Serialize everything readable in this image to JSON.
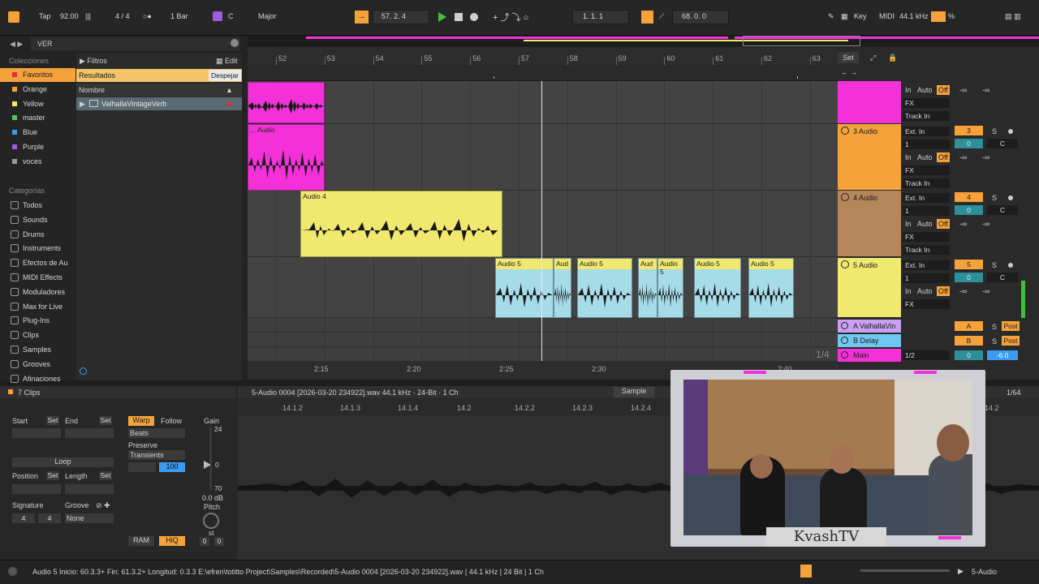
{
  "topbar": {
    "tap": "Tap",
    "tempo": "92.00",
    "meter": "4 / 4",
    "quantize": "1 Bar",
    "key_root": "C",
    "key_scale": "Major",
    "position": "57.   2.   4",
    "loop_start": "1.   1.   1",
    "loop_length": "68.   0.   0",
    "key_label": "Key",
    "midi_label": "MIDI",
    "sample_rate": "44.1 kHz",
    "cpu": "%"
  },
  "browser": {
    "search": "VER",
    "colecciones_title": "Colecciones",
    "colecciones": [
      {
        "label": "Favoritos",
        "color": "#e03030"
      },
      {
        "label": "Orange",
        "color": "#f5a23b"
      },
      {
        "label": "Yellow",
        "color": "#f1e870"
      },
      {
        "label": "master",
        "color": "#58c25a"
      },
      {
        "label": "Blue",
        "color": "#3c9bf0"
      },
      {
        "label": "Purple",
        "color": "#a05be0"
      },
      {
        "label": "voces",
        "color": "#9a9a9a"
      }
    ],
    "categorias_title": "Categorías",
    "categorias": [
      "Todos",
      "Sounds",
      "Drums",
      "Instruments",
      "Efectos de Au",
      "MIDI Effects",
      "Moduladores",
      "Max for Live",
      "Plug-Ins",
      "Clips",
      "Samples",
      "Grooves",
      "Afinaciones"
    ],
    "filtros": "Filtros",
    "edit": "Edit",
    "resultados": "Resultados",
    "despejar": "Despejar",
    "nombre": "Nombre",
    "result_item": "ValhallaVintageVerb"
  },
  "ruler": {
    "bars": [
      "52",
      "53",
      "54",
      "55",
      "56",
      "57",
      "58",
      "59",
      "60",
      "61",
      "62",
      "63"
    ],
    "times": [
      "2:15",
      "2:20",
      "2:25",
      "2:30",
      "2:40"
    ],
    "set": "Set",
    "zoom": "1/4"
  },
  "clips": {
    "audio_top": "... Audio",
    "audio4": "Audio 4",
    "audio5": [
      "Audio 5",
      "Aud",
      "Audio 5",
      "Aud",
      "Audio 5",
      "Audio 5",
      "Audio 5"
    ]
  },
  "tracks": [
    {
      "name": "",
      "color": "#f431d9",
      "in": "In",
      "auto": "Auto",
      "off": "Off",
      "fx": "FX",
      "trackin": "Track In"
    },
    {
      "name": "3 Audio",
      "color": "#f5a23b",
      "extin": "Ext. In",
      "ch": "1",
      "num": "3",
      "vol": "0",
      "pan": "C"
    },
    {
      "name": "4 Audio",
      "color": "#b5865a",
      "extin": "Ext. In",
      "ch": "1",
      "num": "4",
      "vol": "0",
      "pan": "C"
    },
    {
      "name": "5 Audio",
      "color": "#f1e870",
      "extin": "Ext. In",
      "ch": "1",
      "num": "5",
      "vol": "0",
      "pan": "C"
    }
  ],
  "returns": [
    {
      "name": "A ValhallaVin",
      "color": "#c9a0f2",
      "letter": "A",
      "post": "Post"
    },
    {
      "name": "B Delay",
      "color": "#6fc8f0",
      "letter": "B",
      "post": "Post"
    },
    {
      "name": "Main",
      "color": "#f431d9",
      "send": "1/2",
      "vol": "0",
      "db": "-6.0"
    }
  ],
  "mixer_labels": {
    "neg_inf": "-∞",
    "solo": "S"
  },
  "detail": {
    "clips_count": "7 Clips",
    "file": "5-Audio 0004 [2026-03-20 234922].wav  44.1 kHz · 24-Bit · 1 Ch",
    "sample_tab": "Sample",
    "grid": "1/64",
    "start": "Start",
    "set": "Set",
    "end": "End",
    "loop": "Loop",
    "position": "Position",
    "length": "Length",
    "signature": "Signature",
    "groove": "Groove",
    "sig_num": "4",
    "sig_den": "4",
    "groove_val": "None",
    "warp": "Warp",
    "follow": "Follow",
    "beats": "Beats",
    "preserve": "Preserve",
    "transients": "Transients",
    "warp_val": "100",
    "gain": "Gain",
    "gain_top": "24",
    "gain_mid": "0",
    "gain_low": "70",
    "gain_db": "0.0 dB",
    "pitch": "Pitch",
    "st": "st",
    "ram": "RAM",
    "hiq": "HiQ",
    "detune_a": "0",
    "detune_b": "0",
    "timeline": [
      "14.1.2",
      "14.1.3",
      "14.1.4",
      "14.2",
      "14.2.2",
      "14.2.3",
      "14.2.4",
      "14.2"
    ]
  },
  "status": {
    "text": "Audio 5  Inicio: 60.3.3+  Fin: 61.3.2+  Longitud: 0.3.3  E:\\efren\\totitto Project\\Samples\\Recorded\\5-Audio 0004 [2026-03-20 234922].wav | 44.1 kHz | 24 Bit | 1 Ch",
    "track": "5-Audio"
  },
  "webcam": {
    "banner": "KvashTV"
  }
}
